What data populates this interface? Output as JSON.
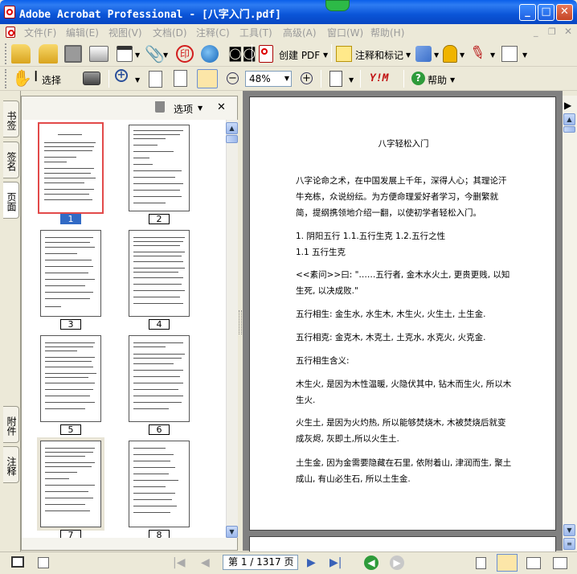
{
  "window": {
    "title": "Adobe Acrobat Professional - [八字入门.pdf]"
  },
  "menu": [
    "文件(F)",
    "编辑(E)",
    "视图(V)",
    "文档(D)",
    "注释(C)",
    "工具(T)",
    "高级(A)",
    "窗口(W)",
    "帮助(H)"
  ],
  "toolbar1": {
    "create_pdf": "创建 PDF",
    "comment_markup": "注释和标记"
  },
  "toolbar2": {
    "select": "选择",
    "zoom": "48%",
    "help": "帮助"
  },
  "side_tabs": {
    "bookmarks": "书签",
    "signatures": "签名",
    "pages": "页面",
    "attachments": "附件",
    "comments": "注释"
  },
  "panel": {
    "options": "选项"
  },
  "thumbnails": [
    "1",
    "2",
    "3",
    "4",
    "5",
    "6",
    "7",
    "8"
  ],
  "document": {
    "title": "八字轻松入门",
    "paragraphs": [
      "八字论命之术，在中国发展上千年，深得人心；其理论汗牛充栋，众说纷纭。为方便命理爱好者学习，今删繁就简，提纲携领地介绍一翻，以使初学者轻松入门。",
      "1. 阴阳五行 1.1.五行生克 1.2.五行之性",
      "1.1 五行生克",
      "<<素问>>曰: \"……五行者, 金木水火土, 更贵更贱, 以知生死, 以决成败.\"",
      "五行相生: 金生水, 水生木, 木生火, 火生土, 土生金.",
      "五行相克: 金克木, 木克土, 土克水, 水克火, 火克金.",
      "五行相生含义:",
      "木生火, 是因为木性温暖, 火隐伏其中, 钻木而生火, 所以木生火.",
      "火生土, 是因为火灼热, 所以能够焚烧木, 木被焚烧后就变成灰烬, 灰即土,所以火生土.",
      "土生金, 因为金需要隐藏在石里, 依附着山, 津润而生, 聚土成山, 有山必生石, 所以土生金."
    ]
  },
  "statusbar": {
    "page_field": "第 1 / 1317 页"
  }
}
